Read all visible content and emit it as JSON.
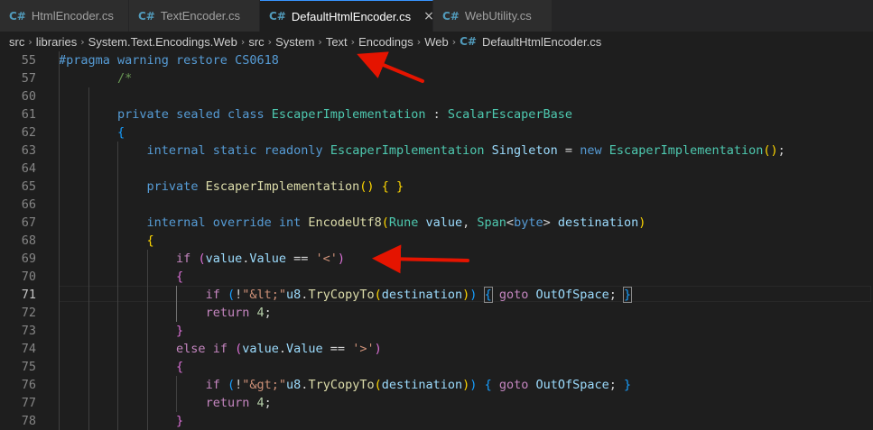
{
  "tabs": [
    {
      "icon": "C#",
      "label": "HtmlEncoder.cs"
    },
    {
      "icon": "C#",
      "label": "TextEncoder.cs"
    },
    {
      "icon": "C#",
      "label": "DefaultHtmlEncoder.cs",
      "close": "×"
    },
    {
      "icon": "C#",
      "label": "WebUtility.cs"
    }
  ],
  "breadcrumb": [
    "src",
    "libraries",
    "System.Text.Encodings.Web",
    "src",
    "System",
    "Text",
    "Encodings",
    "Web"
  ],
  "breadcrumb_file": "DefaultHtmlEncoder.cs",
  "breadcrumb_file_icon": "C#",
  "breadcrumb_separator": "›",
  "lines": [
    {
      "n": "55",
      "t": [
        [
          "kw",
          "#pragma warning restore CS0618"
        ]
      ]
    },
    {
      "n": "57",
      "t": [
        [
          "p",
          "        "
        ],
        [
          "cm",
          "/*"
        ]
      ]
    },
    {
      "n": "60",
      "t": []
    },
    {
      "n": "61",
      "t": [
        [
          "p",
          "        "
        ],
        [
          "kw",
          "private"
        ],
        [
          "p",
          " "
        ],
        [
          "kw",
          "sealed"
        ],
        [
          "p",
          " "
        ],
        [
          "kw",
          "class"
        ],
        [
          "p",
          " "
        ],
        [
          "ty",
          "EscaperImplementation"
        ],
        [
          "p",
          " : "
        ],
        [
          "ty",
          "ScalarEscaperBase"
        ]
      ]
    },
    {
      "n": "62",
      "t": [
        [
          "p",
          "        "
        ],
        [
          "b3",
          "{"
        ]
      ]
    },
    {
      "n": "63",
      "t": [
        [
          "p",
          "            "
        ],
        [
          "kw",
          "internal"
        ],
        [
          "p",
          " "
        ],
        [
          "kw",
          "static"
        ],
        [
          "p",
          " "
        ],
        [
          "kw",
          "readonly"
        ],
        [
          "p",
          " "
        ],
        [
          "ty",
          "EscaperImplementation"
        ],
        [
          "p",
          " "
        ],
        [
          "vr",
          "Singleton"
        ],
        [
          "p",
          " = "
        ],
        [
          "kw",
          "new"
        ],
        [
          "p",
          " "
        ],
        [
          "ty",
          "EscaperImplementation"
        ],
        [
          "b1",
          "()"
        ],
        [
          "p",
          ";"
        ]
      ]
    },
    {
      "n": "64",
      "t": []
    },
    {
      "n": "65",
      "t": [
        [
          "p",
          "            "
        ],
        [
          "kw",
          "private"
        ],
        [
          "p",
          " "
        ],
        [
          "fn",
          "EscaperImplementation"
        ],
        [
          "b1",
          "()"
        ],
        [
          "p",
          " "
        ],
        [
          "b1",
          "{"
        ],
        [
          "p",
          " "
        ],
        [
          "b1",
          "}"
        ]
      ]
    },
    {
      "n": "66",
      "t": []
    },
    {
      "n": "67",
      "t": [
        [
          "p",
          "            "
        ],
        [
          "kw",
          "internal"
        ],
        [
          "p",
          " "
        ],
        [
          "kw",
          "override"
        ],
        [
          "p",
          " "
        ],
        [
          "kw",
          "int"
        ],
        [
          "p",
          " "
        ],
        [
          "fn",
          "EncodeUtf8"
        ],
        [
          "b1",
          "("
        ],
        [
          "ty",
          "Rune"
        ],
        [
          "p",
          " "
        ],
        [
          "vr",
          "value"
        ],
        [
          "p",
          ", "
        ],
        [
          "ty",
          "Span"
        ],
        [
          "p",
          "<"
        ],
        [
          "kw",
          "byte"
        ],
        [
          "p",
          "> "
        ],
        [
          "vr",
          "destination"
        ],
        [
          "b1",
          ")"
        ]
      ]
    },
    {
      "n": "68",
      "t": [
        [
          "p",
          "            "
        ],
        [
          "b1",
          "{"
        ]
      ]
    },
    {
      "n": "69",
      "t": [
        [
          "p",
          "                "
        ],
        [
          "ctl",
          "if"
        ],
        [
          "p",
          " "
        ],
        [
          "b2",
          "("
        ],
        [
          "vr",
          "value"
        ],
        [
          "p",
          "."
        ],
        [
          "vr",
          "Value"
        ],
        [
          "p",
          " == "
        ],
        [
          "st",
          "'<'"
        ],
        [
          "b2",
          ")"
        ]
      ]
    },
    {
      "n": "70",
      "t": [
        [
          "p",
          "                "
        ],
        [
          "b2",
          "{"
        ]
      ]
    },
    {
      "n": "71",
      "t": [
        [
          "p",
          "                    "
        ],
        [
          "ctl",
          "if"
        ],
        [
          "p",
          " "
        ],
        [
          "b3",
          "("
        ],
        [
          "p",
          "!"
        ],
        [
          "st",
          "\"&lt;\""
        ],
        [
          "vr",
          "u8"
        ],
        [
          "p",
          "."
        ],
        [
          "fn",
          "TryCopyTo"
        ],
        [
          "b1",
          "("
        ],
        [
          "vr",
          "destination"
        ],
        [
          "b1",
          ")"
        ],
        [
          "b3",
          ")"
        ],
        [
          "p",
          " "
        ],
        [
          "b3m",
          "{"
        ],
        [
          "p",
          " "
        ],
        [
          "ctl",
          "goto"
        ],
        [
          "p",
          " "
        ],
        [
          "vr",
          "OutOfSpace"
        ],
        [
          "p",
          "; "
        ],
        [
          "b3m",
          "}"
        ]
      ]
    },
    {
      "n": "72",
      "t": [
        [
          "p",
          "                    "
        ],
        [
          "ctl",
          "return"
        ],
        [
          "p",
          " "
        ],
        [
          "nm",
          "4"
        ],
        [
          "p",
          ";"
        ]
      ]
    },
    {
      "n": "73",
      "t": [
        [
          "p",
          "                "
        ],
        [
          "b2",
          "}"
        ]
      ]
    },
    {
      "n": "74",
      "t": [
        [
          "p",
          "                "
        ],
        [
          "ctl",
          "else"
        ],
        [
          "p",
          " "
        ],
        [
          "ctl",
          "if"
        ],
        [
          "p",
          " "
        ],
        [
          "b2",
          "("
        ],
        [
          "vr",
          "value"
        ],
        [
          "p",
          "."
        ],
        [
          "vr",
          "Value"
        ],
        [
          "p",
          " == "
        ],
        [
          "st",
          "'>'"
        ],
        [
          "b2",
          ")"
        ]
      ]
    },
    {
      "n": "75",
      "t": [
        [
          "p",
          "                "
        ],
        [
          "b2",
          "{"
        ]
      ]
    },
    {
      "n": "76",
      "t": [
        [
          "p",
          "                    "
        ],
        [
          "ctl",
          "if"
        ],
        [
          "p",
          " "
        ],
        [
          "b3",
          "("
        ],
        [
          "p",
          "!"
        ],
        [
          "st",
          "\"&gt;\""
        ],
        [
          "vr",
          "u8"
        ],
        [
          "p",
          "."
        ],
        [
          "fn",
          "TryCopyTo"
        ],
        [
          "b1",
          "("
        ],
        [
          "vr",
          "destination"
        ],
        [
          "b1",
          ")"
        ],
        [
          "b3",
          ")"
        ],
        [
          "p",
          " "
        ],
        [
          "b3",
          "{"
        ],
        [
          "p",
          " "
        ],
        [
          "ctl",
          "goto"
        ],
        [
          "p",
          " "
        ],
        [
          "vr",
          "OutOfSpace"
        ],
        [
          "p",
          "; "
        ],
        [
          "b3",
          "}"
        ]
      ]
    },
    {
      "n": "77",
      "t": [
        [
          "p",
          "                    "
        ],
        [
          "ctl",
          "return"
        ],
        [
          "p",
          " "
        ],
        [
          "nm",
          "4"
        ],
        [
          "p",
          ";"
        ]
      ]
    },
    {
      "n": "78",
      "t": [
        [
          "p",
          "                "
        ],
        [
          "b2",
          "}"
        ]
      ]
    }
  ],
  "current_line": "71",
  "annotation_color": "#e51400"
}
